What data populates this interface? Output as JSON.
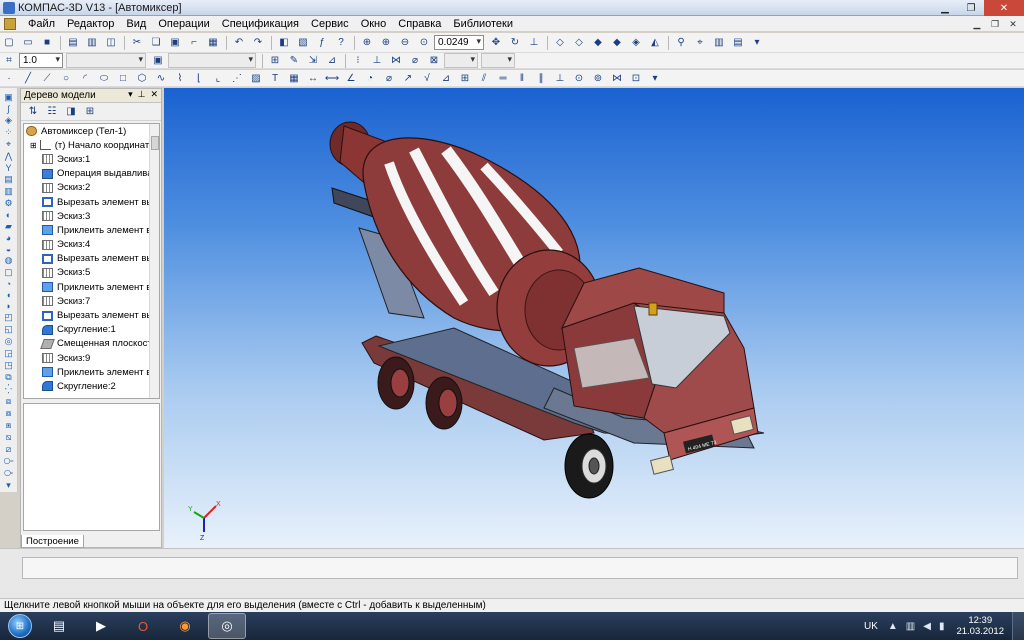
{
  "window": {
    "title": "КОМПАС-3D V13 - [Автомиксер]"
  },
  "menu": [
    "Файл",
    "Редактор",
    "Вид",
    "Операции",
    "Спецификация",
    "Сервис",
    "Окно",
    "Справка",
    "Библиотеки"
  ],
  "toolbar": {
    "zoom_value": "0.0249",
    "step_value": "1.0"
  },
  "tree": {
    "panel_title": "Дерево модели",
    "tab_label": "Построение",
    "items": [
      {
        "icon": "part",
        "label": "Автомиксер (Тел-1)"
      },
      {
        "icon": "origin",
        "label": "(т) Начало координат"
      },
      {
        "icon": "sketch",
        "label": "Эскиз:1"
      },
      {
        "icon": "extrude",
        "label": "Операция выдавлива"
      },
      {
        "icon": "sketch",
        "label": "Эскиз:2"
      },
      {
        "icon": "cut",
        "label": "Вырезать элемент вы"
      },
      {
        "icon": "sketch",
        "label": "Эскиз:3"
      },
      {
        "icon": "add",
        "label": "Приклеить элемент в"
      },
      {
        "icon": "sketch",
        "label": "Эскиз:4"
      },
      {
        "icon": "cut",
        "label": "Вырезать элемент вы"
      },
      {
        "icon": "sketch",
        "label": "Эскиз:5"
      },
      {
        "icon": "add",
        "label": "Приклеить элемент в"
      },
      {
        "icon": "sketch",
        "label": "Эскиз:7"
      },
      {
        "icon": "cut",
        "label": "Вырезать элемент вы"
      },
      {
        "icon": "fillet",
        "label": "Скругление:1"
      },
      {
        "icon": "plane",
        "label": "Смещенная плоскост"
      },
      {
        "icon": "sketch",
        "label": "Эскиз:9"
      },
      {
        "icon": "add",
        "label": "Приклеить элемент в"
      },
      {
        "icon": "fillet",
        "label": "Скругление:2"
      }
    ]
  },
  "viewport": {
    "triad": {
      "x": "X",
      "y": "Y",
      "z": "Z"
    },
    "plate_text": "Н 404 МЕ 73"
  },
  "status": {
    "hint": "Щелкните левой кнопкой мыши на объекте для его выделения (вместе с Ctrl - добавить к выделенным)"
  },
  "taskbar": {
    "lang": "UK",
    "time": "12:39",
    "date": "21.03.2012"
  }
}
